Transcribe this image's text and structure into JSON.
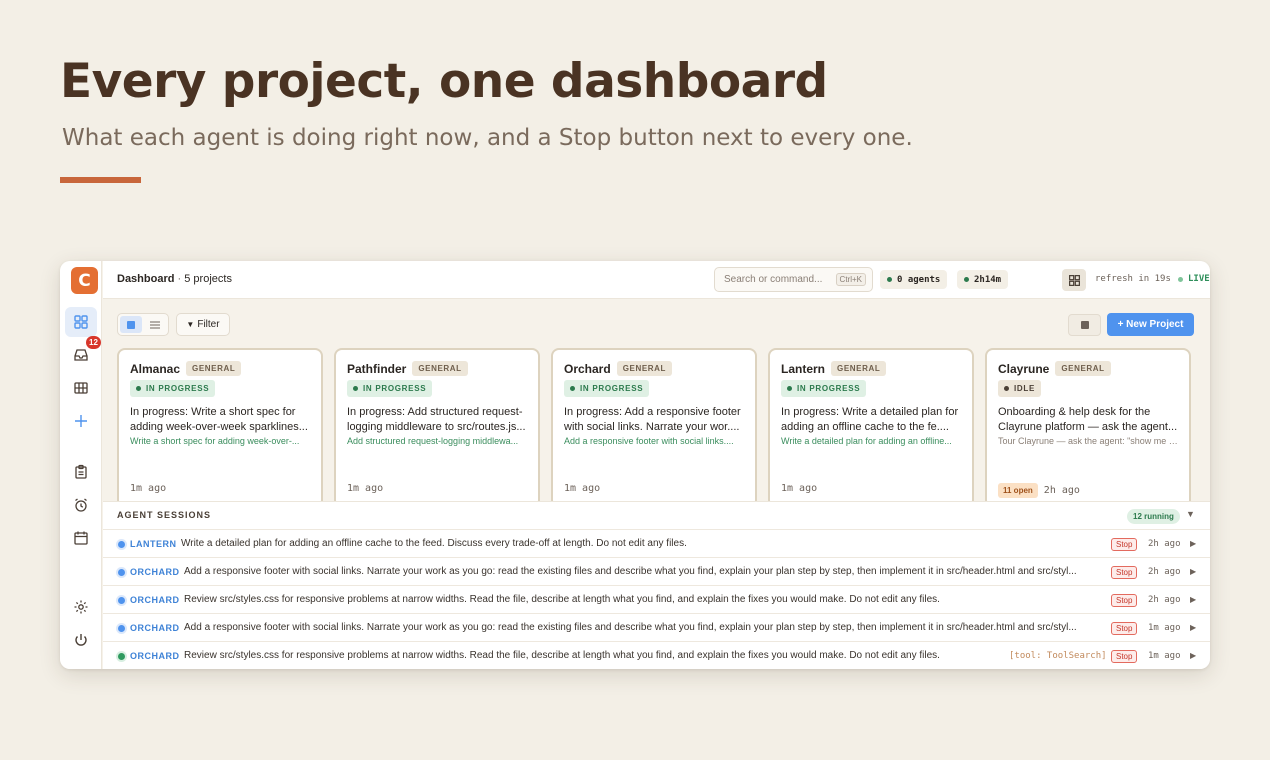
{
  "hero": {
    "title": "Every project, one dashboard",
    "subtitle": "What each agent is doing right now, and a Stop button next to every one."
  },
  "colors": {
    "accent": "#c8663b",
    "brand": "#e46f33",
    "primary": "#4f93ee",
    "success": "#2c7a4d",
    "danger": "#c5372b"
  },
  "sidebar": {
    "logo": "C",
    "inbox_badge": "12",
    "icons": [
      "grid-icon",
      "inbox-icon",
      "board-icon",
      "plus-icon",
      "clipboard-icon",
      "alarm-icon",
      "calendar-icon",
      "settings-icon",
      "power-icon"
    ]
  },
  "topbar": {
    "title": "Dashboard",
    "separator": " · ",
    "subtitle": "5 projects",
    "search_placeholder": "Search or command...",
    "search_shortcut": "Ctrl+K",
    "agents": "0 agents",
    "uptime": "2h14m",
    "refresh": "refresh in 19s",
    "live": "LIVE",
    "help": "?"
  },
  "toolbar": {
    "filter": "Filter",
    "new_project": "+ New Project"
  },
  "cards": [
    {
      "name": "Almanac",
      "tag": "GENERAL",
      "status": "IN PROGRESS",
      "title": "In progress: Write a short spec for adding week-over-week sparklines...",
      "task": "Write a short spec for adding week-over-...",
      "time": "1m ago"
    },
    {
      "name": "Pathfinder",
      "tag": "GENERAL",
      "status": "IN PROGRESS",
      "title": "In progress: Add structured request-logging middleware to src/routes.js...",
      "task": "Add structured request-logging middlewa...",
      "time": "1m ago"
    },
    {
      "name": "Orchard",
      "tag": "GENERAL",
      "status": "IN PROGRESS",
      "title": "In progress: Add a responsive footer with social links. Narrate your wor....",
      "task": "Add a responsive footer with social links....",
      "time": "1m ago"
    },
    {
      "name": "Lantern",
      "tag": "GENERAL",
      "status": "IN PROGRESS",
      "title": "In progress: Write a detailed plan for adding an offline cache to the fe....",
      "task": "Write a detailed plan for adding an offline...",
      "time": "1m ago"
    },
    {
      "name": "Clayrune",
      "tag": "GENERAL",
      "status": "IDLE",
      "title": "Onboarding & help desk for the Clayrune platform — ask the agent...",
      "task": "Tour Clayrune — ask the agent: \"show me wh...",
      "open": "11 open",
      "time": "2h ago"
    }
  ],
  "sessions": {
    "heading": "AGENT SESSIONS",
    "running": "12 running",
    "stop_label": "Stop",
    "rows": [
      {
        "project": "LANTERN",
        "text": "Write a detailed plan for adding an offline cache to the feed. Discuss every trade-off at length. Do not edit any files.",
        "tool": "",
        "time": "2h ago",
        "dot": "#4f93ee"
      },
      {
        "project": "ORCHARD",
        "text": "Add a responsive footer with social links. Narrate your work as you go: read the existing files and describe what you find, explain your plan step by step, then implement it in src/header.html and src/styl...",
        "tool": "",
        "time": "2h ago",
        "dot": "#4f93ee"
      },
      {
        "project": "ORCHARD",
        "text": "Review src/styles.css for responsive problems at narrow widths. Read the file, describe at length what you find, and explain the fixes you would make. Do not edit any files.",
        "tool": "",
        "time": "2h ago",
        "dot": "#4f93ee"
      },
      {
        "project": "ORCHARD",
        "text": "Add a responsive footer with social links. Narrate your work as you go: read the existing files and describe what you find, explain your plan step by step, then implement it in src/header.html and src/styl...",
        "tool": "",
        "time": "1m ago",
        "dot": "#4f93ee"
      },
      {
        "project": "ORCHARD",
        "text": "Review src/styles.css for responsive problems at narrow widths. Read the file, describe at length what you find, and explain the fixes you would make. Do not edit any files.",
        "tool": "[tool: ToolSearch]",
        "time": "1m ago",
        "dot": "#2f9a5f"
      }
    ]
  }
}
